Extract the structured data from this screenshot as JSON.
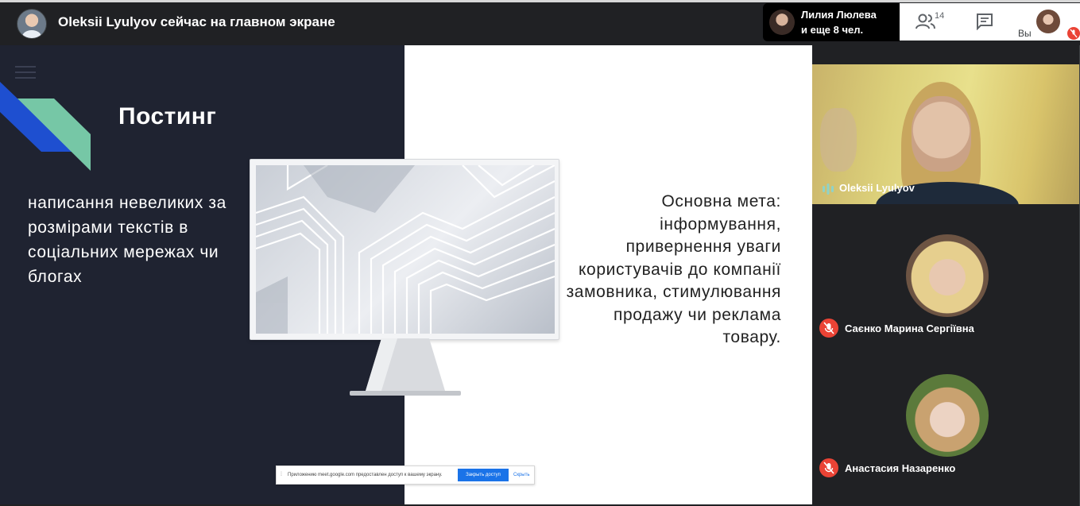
{
  "topbar": {
    "presenting_title": "Oleksii Lyulyov сейчас на главном экране",
    "speaker_name": "Лилия Люлева",
    "speaker_more": "и еще 8 чел.",
    "people_count": "14",
    "self_label": "Вы"
  },
  "slide": {
    "title": "Постинг",
    "left_text": "написання невеликих за розмірами текстів в соціальних мережах чи блогах",
    "right_text": "Основна мета: інформування, привернення уваги користувачів до компанії замовника, стимулювання продажу чи реклама товару."
  },
  "share_bar": {
    "message": "Приложению meet.google.com предоставлен доступ к вашему экрану.",
    "stop_label": "Закрыть доступ",
    "hide_label": "Скрыть"
  },
  "participants": [
    {
      "name": "Oleksii Lyulyov",
      "mic": "speaking"
    },
    {
      "name": "Саєнко Марина Сергіївна",
      "mic": "muted"
    },
    {
      "name": "Анастасия Назаренко",
      "mic": "muted"
    }
  ],
  "colors": {
    "accent_blue": "#1a73e8",
    "mute_red": "#ea4335",
    "slide_dark": "#1f2331",
    "speaking_teal": "#8fd3c8"
  },
  "icons": [
    "people-icon",
    "chat-icon",
    "menu-icon",
    "mic-off-icon",
    "audio-level-icon"
  ]
}
